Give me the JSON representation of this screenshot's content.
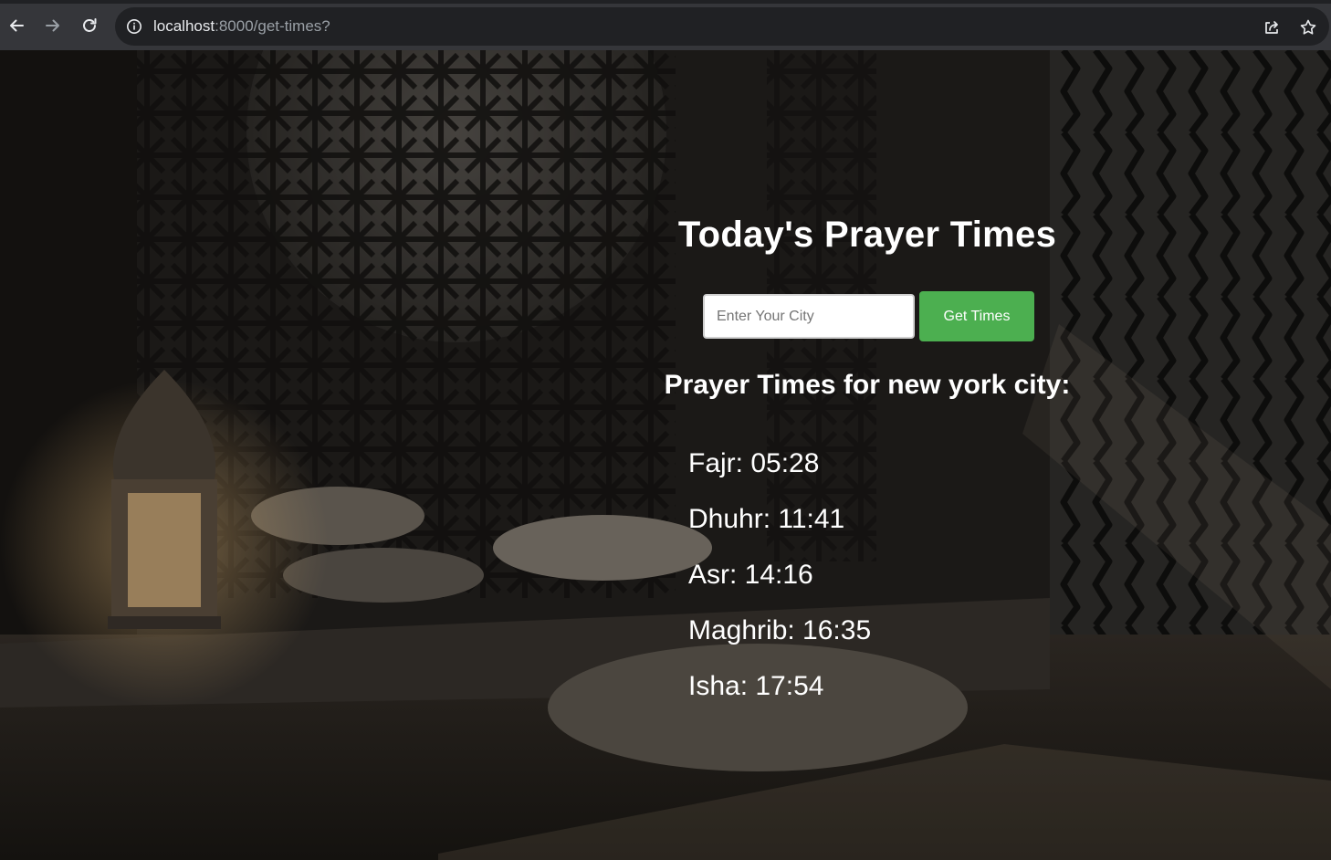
{
  "browser": {
    "url_host": "localhost",
    "url_rest": ":8000/get-times?"
  },
  "page": {
    "title": "Today's Prayer Times",
    "city_input": {
      "placeholder": "Enter Your City",
      "value": ""
    },
    "submit_label": "Get Times",
    "results_heading": "Prayer Times for new york city:",
    "prayer_times": [
      "Fajr: 05:28",
      "Dhuhr: 11:41",
      "Asr: 14:16",
      "Maghrib: 16:35",
      "Isha: 17:54"
    ]
  },
  "colors": {
    "button_green": "#4caf50",
    "text": "#ffffff",
    "chrome_bar": "#35363a",
    "omnibox": "#202124"
  },
  "icons": [
    "back-icon",
    "forward-icon",
    "reload-icon",
    "site-info-icon",
    "share-icon",
    "bookmark-star-icon"
  ]
}
